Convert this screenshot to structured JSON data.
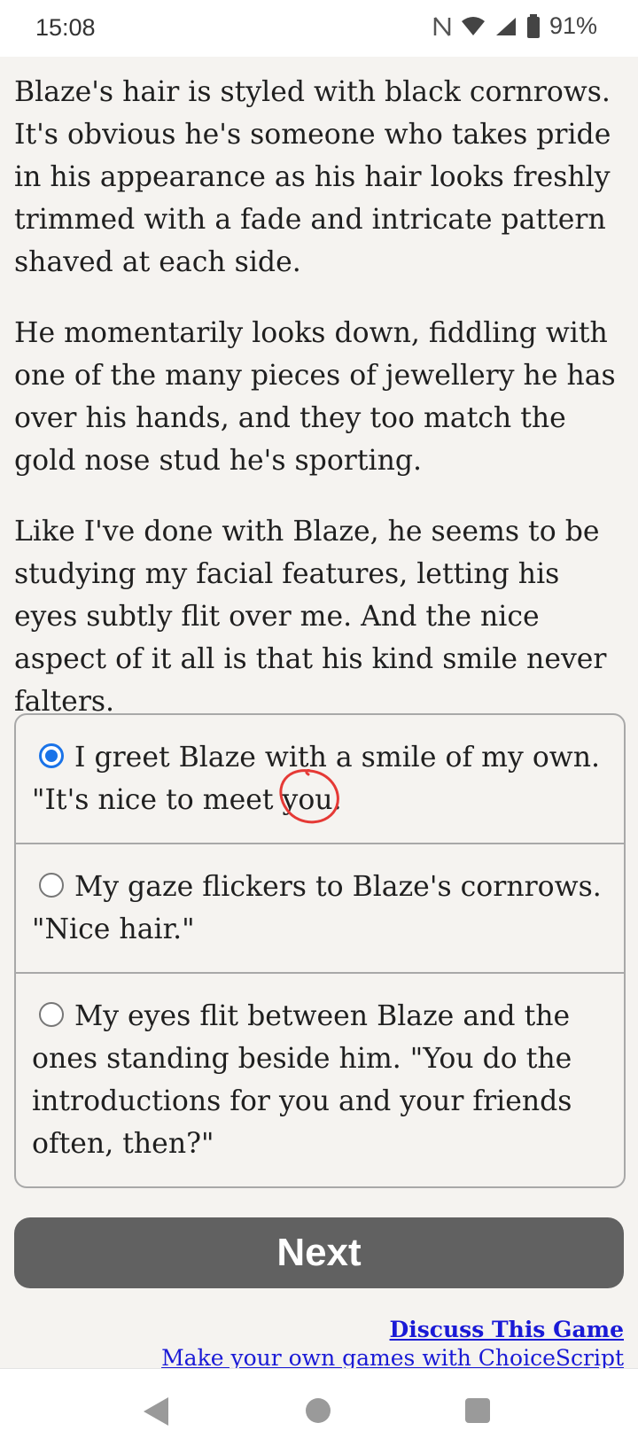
{
  "status_bar": {
    "time": "15:08",
    "battery_percent": "91%",
    "icons": [
      "nfc-icon",
      "wifi-icon",
      "signal-icon",
      "battery-icon"
    ]
  },
  "story": {
    "paragraphs": [
      "Blaze's hair is styled with black cornrows. It's obvious he's someone who takes pride in his appearance as his hair looks freshly trimmed with a fade and intricate pattern shaved at each side.",
      "He momentarily looks down, fiddling with one of the many pieces of jewellery he has over his hands, and they too match the gold nose stud he's sporting.",
      "Like I've done with Blaze, he seems to be studying my facial features, letting his eyes subtly flit over me. And the nice aspect of it all is that his kind smile never falters."
    ]
  },
  "choices": [
    {
      "label": "I greet Blaze with a smile of my own. \"It's nice to meet you.",
      "selected": true
    },
    {
      "label": "My gaze flickers to Blaze's cornrows. \"Nice hair.\"",
      "selected": false
    },
    {
      "label": "My eyes flit between Blaze and the ones standing beside him. \"You do the introductions for you and your friends often, then?\"",
      "selected": false
    }
  ],
  "next_button": {
    "label": "Next"
  },
  "links": {
    "discuss": "Discuss This Game",
    "make": "Make your own games with ChoiceScript"
  },
  "colors": {
    "background": "#f5f3f0",
    "accent": "#1a73e8",
    "button": "#616161",
    "link": "#1a1ad6",
    "annotation": "#e53935"
  }
}
